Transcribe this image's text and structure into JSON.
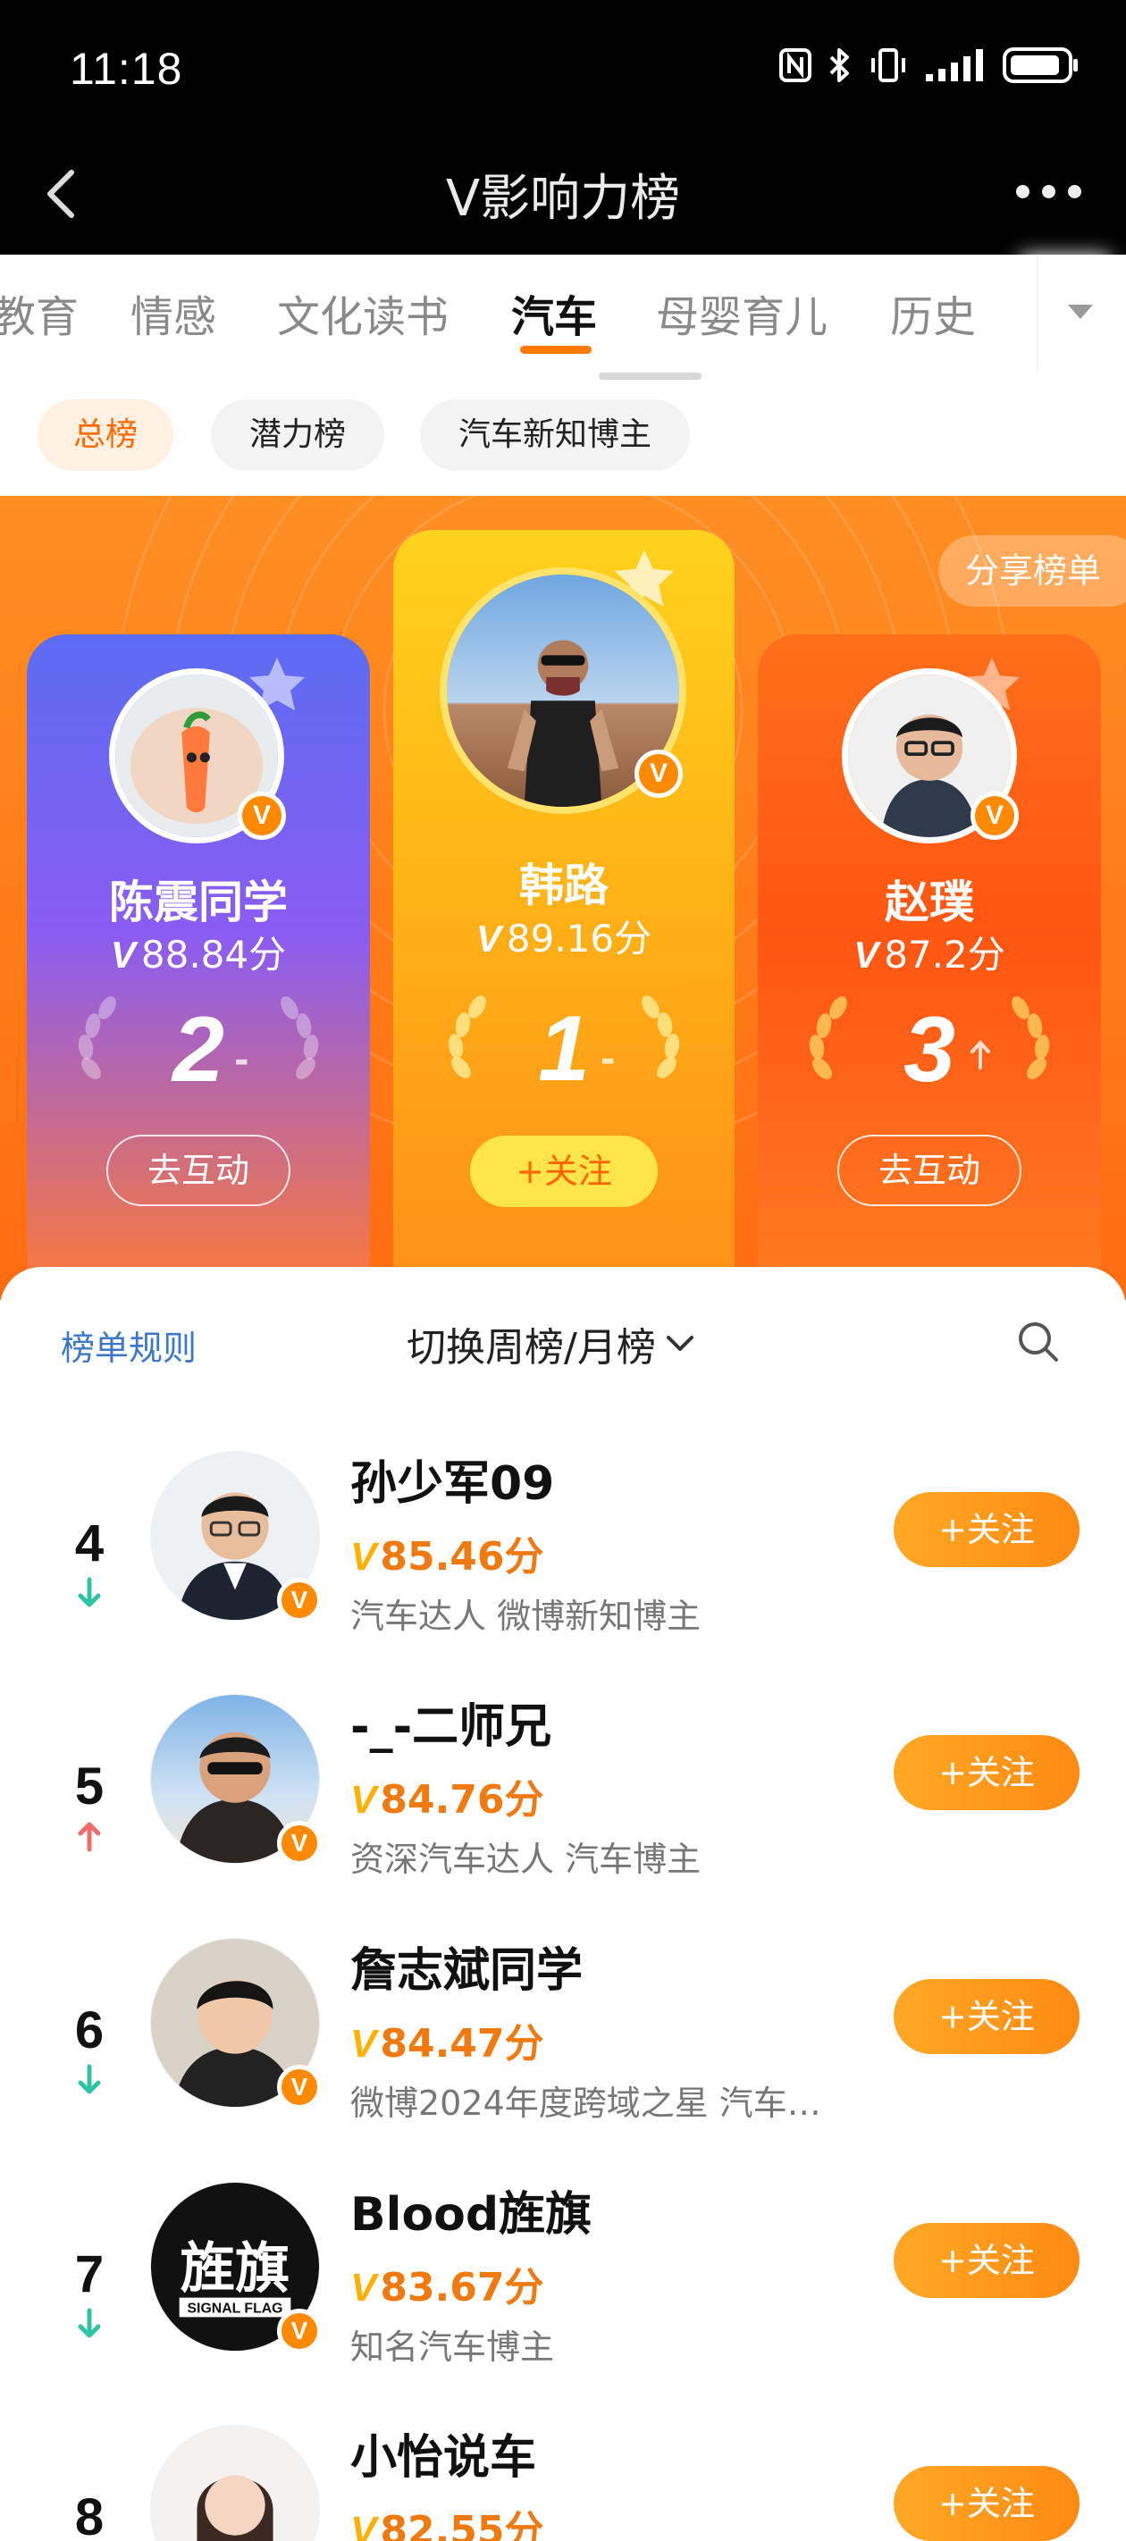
{
  "status_bar": {
    "time": "11:18"
  },
  "nav": {
    "title": "V影响力榜"
  },
  "tabs": [
    {
      "label": "教育",
      "active": false
    },
    {
      "label": "情感",
      "active": false
    },
    {
      "label": "文化读书",
      "active": false
    },
    {
      "label": "汽车",
      "active": true
    },
    {
      "label": "母婴育儿",
      "active": false
    },
    {
      "label": "历史",
      "active": false
    }
  ],
  "subtabs": [
    {
      "label": "总榜",
      "active": true
    },
    {
      "label": "潜力榜",
      "active": false
    },
    {
      "label": "汽车新知博主",
      "active": false
    }
  ],
  "hero": {
    "share_label": "分享榜单",
    "cards": {
      "rank1": {
        "name": "韩路",
        "score": "89.16分",
        "rank": "1",
        "trend": "-",
        "button": "+关注"
      },
      "rank2": {
        "name": "陈震同学",
        "score": "88.84分",
        "rank": "2",
        "trend": "-",
        "button": "去互动"
      },
      "rank3": {
        "name": "赵璞",
        "score": "87.2分",
        "rank": "3",
        "trend": "up",
        "button": "去互动"
      }
    }
  },
  "list_header": {
    "rules": "榜单规则",
    "switch": "切换周榜/月榜"
  },
  "list": [
    {
      "rank": "4",
      "trend": "down",
      "name": "孙少军09",
      "score": "85.46分",
      "desc": "汽车达人 微博新知博主",
      "button": "+关注"
    },
    {
      "rank": "5",
      "trend": "up",
      "name": "-_-二师兄",
      "score": "84.76分",
      "desc": "资深汽车达人 汽车博主",
      "button": "+关注"
    },
    {
      "rank": "6",
      "trend": "down",
      "name": "詹志斌同学",
      "score": "84.47分",
      "desc": "微博2024年度跨域之星 汽车…",
      "button": "+关注"
    },
    {
      "rank": "7",
      "trend": "down",
      "name": "Blood旌旗",
      "score": "83.67分",
      "desc": "知名汽车博主",
      "button": "+关注",
      "avatar_text": "旌旗",
      "avatar_subtext": "SIGNAL FLAG"
    },
    {
      "rank": "8",
      "trend": "",
      "name": "小怡说车",
      "score": "82.55分",
      "desc": "",
      "button": "+关注"
    }
  ],
  "colors": {
    "accent": "#ff7a00",
    "score": "#f07a10",
    "trend_up": "#f26a6a",
    "trend_down": "#2ec4a2"
  }
}
